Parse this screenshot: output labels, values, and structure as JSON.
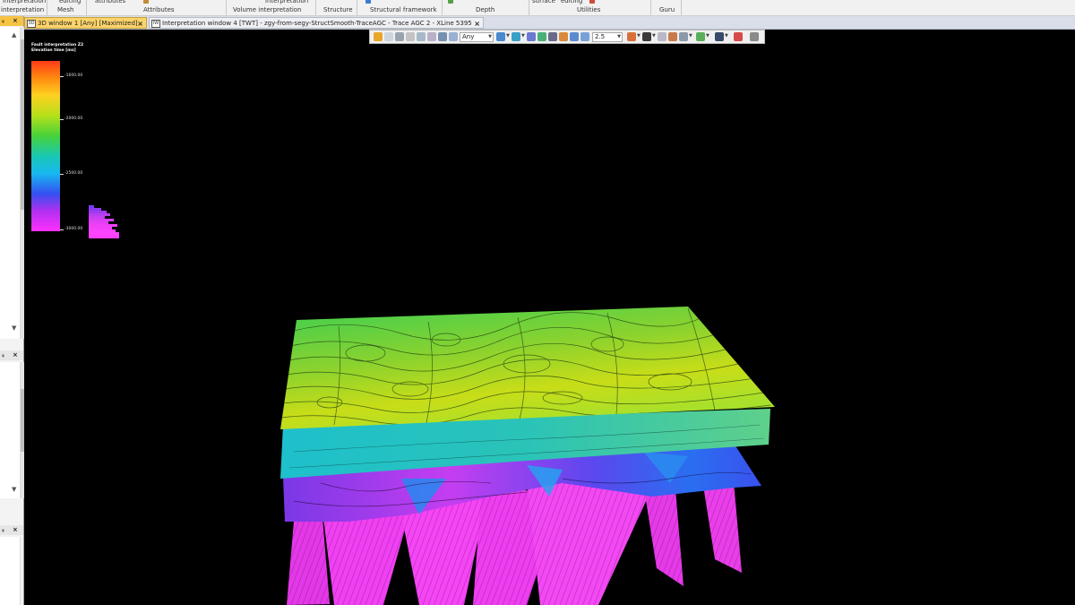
{
  "ribbon": {
    "top_labels": [
      "interpretation",
      "editing",
      "attributes",
      "interpretation",
      "surface",
      "editing"
    ],
    "groups": [
      "interpretation",
      "Mesh",
      "Attributes",
      "Volume interpretation",
      "Structure",
      "Structural framework",
      "Depth",
      "Utilities",
      "Guru"
    ]
  },
  "tabs": [
    {
      "icon": "3D",
      "label": "3D window 1 [Any] [Maximized]",
      "active": true
    },
    {
      "icon": "IW",
      "label": "Interpretation window 4 [TWT] - zgy-from-segy-StructSmooth-TraceAGC - Trace AGC 2 - XLine 5395",
      "active": false
    }
  ],
  "toolbar": {
    "combo_any": "Any",
    "combo_size": "2.5"
  },
  "colorbar": {
    "title_line1": "Fault interpretation Z2",
    "title_line2": "Elevation time [ms]",
    "labels": [
      "-1600.00",
      "-2000.00",
      "-2500.00",
      "-3000.00"
    ],
    "colors": [
      "#ff3a1a",
      "#ff8a10",
      "#ffd020",
      "#b6e01a",
      "#48d23a",
      "#18c8b4",
      "#18b8f0",
      "#3450f0",
      "#b030f0",
      "#ff30ff"
    ]
  },
  "accent": {
    "active_tab": "#fcd46a",
    "ribbon_bg": "#f1f1f1",
    "viewport_bg": "#000000"
  }
}
